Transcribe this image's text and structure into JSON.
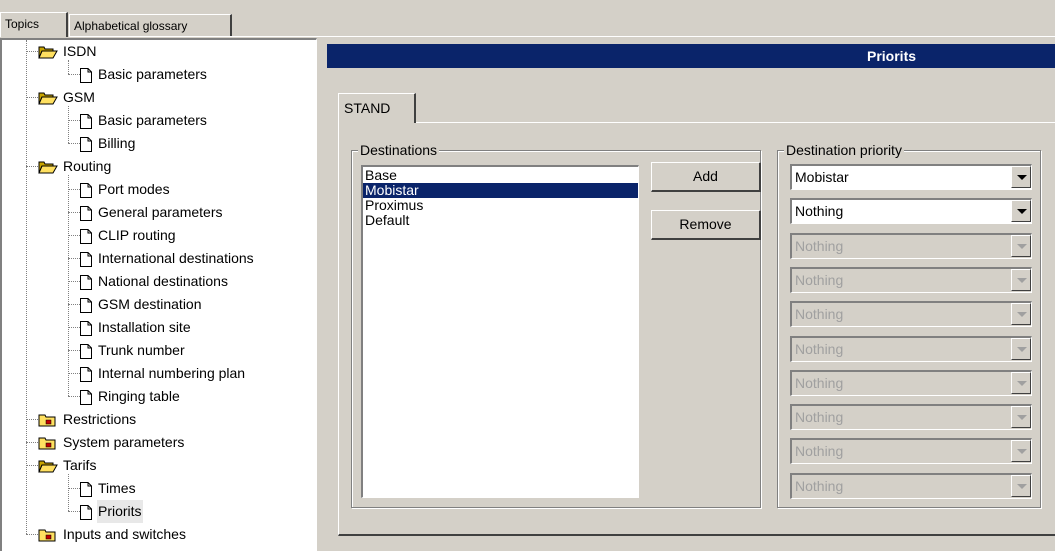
{
  "top_tabs": {
    "topics": "Topics",
    "glossary": "Alphabetical glossary"
  },
  "tree": [
    {
      "label": "ISDN",
      "type": "folder-open"
    },
    {
      "label": "Basic parameters",
      "type": "page"
    },
    {
      "label": "GSM",
      "type": "folder-open"
    },
    {
      "label": "Basic parameters",
      "type": "page"
    },
    {
      "label": "Billing",
      "type": "page"
    },
    {
      "label": "Routing",
      "type": "folder-open"
    },
    {
      "label": "Port modes",
      "type": "page"
    },
    {
      "label": "General parameters",
      "type": "page"
    },
    {
      "label": "CLIP routing",
      "type": "page"
    },
    {
      "label": "International destinations",
      "type": "page"
    },
    {
      "label": "National destinations",
      "type": "page"
    },
    {
      "label": "GSM destination",
      "type": "page"
    },
    {
      "label": "Installation site",
      "type": "page"
    },
    {
      "label": "Trunk number",
      "type": "page"
    },
    {
      "label": "Internal numbering plan",
      "type": "page"
    },
    {
      "label": "Ringing table",
      "type": "page"
    },
    {
      "label": "Restrictions",
      "type": "folder-closed"
    },
    {
      "label": "System parameters",
      "type": "folder-closed"
    },
    {
      "label": "Tarifs",
      "type": "folder-open"
    },
    {
      "label": "Times",
      "type": "page"
    },
    {
      "label": "Priorits",
      "type": "page",
      "selected": true
    },
    {
      "label": "Inputs and switches",
      "type": "folder-closed"
    }
  ],
  "header": {
    "title": "Priorits"
  },
  "tab": {
    "label": "STAND"
  },
  "destinations": {
    "caption": "Destinations",
    "items": [
      "Base",
      "Mobistar",
      "Proximus",
      "Default"
    ],
    "selected": "Mobistar"
  },
  "buttons": {
    "add": "Add",
    "remove": "Remove"
  },
  "priority": {
    "caption": "Destination priority",
    "slots": [
      {
        "value": "Mobistar",
        "enabled": true
      },
      {
        "value": "Nothing",
        "enabled": true
      },
      {
        "value": "Nothing",
        "enabled": false
      },
      {
        "value": "Nothing",
        "enabled": false
      },
      {
        "value": "Nothing",
        "enabled": false
      },
      {
        "value": "Nothing",
        "enabled": false
      },
      {
        "value": "Nothing",
        "enabled": false
      },
      {
        "value": "Nothing",
        "enabled": false
      },
      {
        "value": "Nothing",
        "enabled": false
      },
      {
        "value": "Nothing",
        "enabled": false
      }
    ]
  },
  "colors": {
    "selection": "#0a246a",
    "background": "#d4d0c8"
  }
}
